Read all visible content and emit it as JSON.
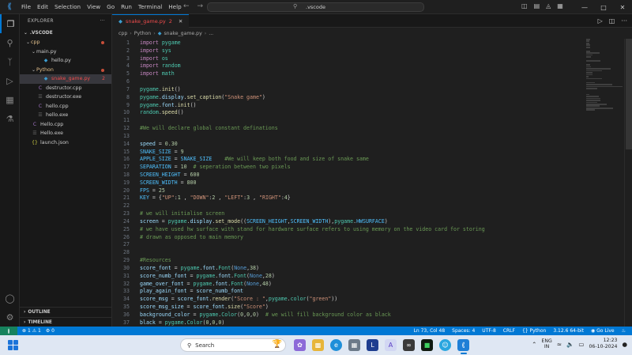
{
  "titlebar": {
    "menu": [
      "File",
      "Edit",
      "Selection",
      "View",
      "Go",
      "Run",
      "Terminal",
      "Help"
    ],
    "command_center": ".vscode"
  },
  "sidebar": {
    "header": "EXPLORER",
    "workspace": ".VSCODE",
    "tree": [
      {
        "label": "cpp",
        "depth": 1,
        "type": "folder",
        "open": true,
        "status": "dot"
      },
      {
        "label": "main.py",
        "depth": 2,
        "type": "folder",
        "open": true
      },
      {
        "label": "hello.py",
        "depth": 3,
        "type": "py"
      },
      {
        "label": "Python",
        "depth": 2,
        "type": "folder",
        "open": true,
        "status": "dot"
      },
      {
        "label": "snake_game.py",
        "depth": 3,
        "type": "py",
        "badge": "2",
        "selected": true
      },
      {
        "label": "destructor.cpp",
        "depth": 2,
        "type": "cpp"
      },
      {
        "label": "destructor.exe",
        "depth": 2,
        "type": "exe"
      },
      {
        "label": "hello.cpp",
        "depth": 2,
        "type": "cpp"
      },
      {
        "label": "hello.exe",
        "depth": 2,
        "type": "exe"
      },
      {
        "label": "Hello.cpp",
        "depth": 1,
        "type": "cpp"
      },
      {
        "label": "Hello.exe",
        "depth": 1,
        "type": "exe"
      },
      {
        "label": "launch.json",
        "depth": 1,
        "type": "json"
      }
    ],
    "outline": "OUTLINE",
    "timeline": "TIMELINE"
  },
  "editor": {
    "tab": {
      "label": "snake_game.py",
      "problems": "2"
    },
    "breadcrumb": [
      "cpp",
      "Python",
      "snake_game.py",
      "..."
    ],
    "lines": [
      [
        [
          "kw",
          "import"
        ],
        [
          "t",
          " "
        ],
        [
          "mod",
          "pygame"
        ]
      ],
      [
        [
          "kw",
          "import"
        ],
        [
          "t",
          " "
        ],
        [
          "mod",
          "sys"
        ]
      ],
      [
        [
          "kw",
          "import"
        ],
        [
          "t",
          " "
        ],
        [
          "mod",
          "os"
        ]
      ],
      [
        [
          "kw",
          "import"
        ],
        [
          "t",
          " "
        ],
        [
          "mod",
          "random"
        ]
      ],
      [
        [
          "kw",
          "import"
        ],
        [
          "t",
          " "
        ],
        [
          "mod",
          "math"
        ]
      ],
      [],
      [
        [
          "mod",
          "pygame"
        ],
        [
          "t",
          "."
        ],
        [
          "fn",
          "init"
        ],
        [
          "t",
          "()"
        ]
      ],
      [
        [
          "mod",
          "pygame"
        ],
        [
          "t",
          "."
        ],
        [
          "var",
          "display"
        ],
        [
          "t",
          "."
        ],
        [
          "fn",
          "set_caption"
        ],
        [
          "t",
          "("
        ],
        [
          "str",
          "\"Snake game\""
        ],
        [
          "t",
          ")"
        ]
      ],
      [
        [
          "mod",
          "pygame"
        ],
        [
          "t",
          "."
        ],
        [
          "var",
          "font"
        ],
        [
          "t",
          "."
        ],
        [
          "fn",
          "init"
        ],
        [
          "t",
          "()"
        ]
      ],
      [
        [
          "mod",
          "random"
        ],
        [
          "t",
          "."
        ],
        [
          "fn",
          "speed"
        ],
        [
          "t",
          "()"
        ]
      ],
      [],
      [
        [
          "cmt",
          "#We will declare global constant definations"
        ]
      ],
      [],
      [
        [
          "var",
          "speed"
        ],
        [
          "t",
          " = "
        ],
        [
          "num",
          "0.30"
        ]
      ],
      [
        [
          "const",
          "SNAKE_SIZE"
        ],
        [
          "t",
          " = "
        ],
        [
          "num",
          "9"
        ]
      ],
      [
        [
          "const",
          "APPLE_SIZE"
        ],
        [
          "t",
          " = "
        ],
        [
          "const",
          "SNAKE_SIZE"
        ],
        [
          "t",
          "    "
        ],
        [
          "cmt",
          "#We will keep both food and size of snake same"
        ]
      ],
      [
        [
          "const",
          "SEPARATION"
        ],
        [
          "t",
          " = "
        ],
        [
          "num",
          "10"
        ],
        [
          "t",
          "  "
        ],
        [
          "cmt",
          "# seperation between two pixels"
        ]
      ],
      [
        [
          "const",
          "SCREEN_HEIGHT"
        ],
        [
          "t",
          " = "
        ],
        [
          "num",
          "600"
        ]
      ],
      [
        [
          "const",
          "SCREEN_WIDTH"
        ],
        [
          "t",
          " = "
        ],
        [
          "num",
          "800"
        ]
      ],
      [
        [
          "const",
          "FPS"
        ],
        [
          "t",
          " = "
        ],
        [
          "num",
          "25"
        ]
      ],
      [
        [
          "const",
          "KEY"
        ],
        [
          "t",
          " = {"
        ],
        [
          "str",
          "\"UP\""
        ],
        [
          "t",
          ":"
        ],
        [
          "num",
          "1"
        ],
        [
          "t",
          " , "
        ],
        [
          "str",
          "\"DOWN\""
        ],
        [
          "t",
          ":"
        ],
        [
          "num",
          "2"
        ],
        [
          "t",
          " , "
        ],
        [
          "str",
          "\"LEFT\""
        ],
        [
          "t",
          ":"
        ],
        [
          "num",
          "3"
        ],
        [
          "t",
          " , "
        ],
        [
          "str",
          "\"RIGHT\""
        ],
        [
          "t",
          ":"
        ],
        [
          "num",
          "4"
        ],
        [
          "t",
          "}"
        ]
      ],
      [],
      [
        [
          "cmt",
          "# we will initialise screen"
        ]
      ],
      [
        [
          "var",
          "screen"
        ],
        [
          "t",
          " = "
        ],
        [
          "mod",
          "pygame"
        ],
        [
          "t",
          "."
        ],
        [
          "var",
          "display"
        ],
        [
          "t",
          "."
        ],
        [
          "fn",
          "set_mode"
        ],
        [
          "t",
          "(("
        ],
        [
          "const",
          "SCREEN_HEIGHT"
        ],
        [
          "t",
          ","
        ],
        [
          "const",
          "SCREEN_WIDTH"
        ],
        [
          "t",
          "),"
        ],
        [
          "mod",
          "pygame"
        ],
        [
          "t",
          "."
        ],
        [
          "const",
          "HWSURFACE"
        ],
        [
          "t",
          ")"
        ]
      ],
      [
        [
          "cmt",
          "# we have used hw surface with stand for hardware surface refers to using memory on the video card for storing"
        ]
      ],
      [
        [
          "cmt",
          "# drawn as opposed to main memory"
        ]
      ],
      [],
      [],
      [
        [
          "cmt",
          "#Resources"
        ]
      ],
      [
        [
          "var",
          "score_font"
        ],
        [
          "t",
          " = "
        ],
        [
          "mod",
          "pygame"
        ],
        [
          "t",
          "."
        ],
        [
          "var",
          "font"
        ],
        [
          "t",
          "."
        ],
        [
          "mod",
          "Font"
        ],
        [
          "t",
          "("
        ],
        [
          "kw2",
          "None"
        ],
        [
          "t",
          ","
        ],
        [
          "num",
          "38"
        ],
        [
          "t",
          ")"
        ]
      ],
      [
        [
          "var",
          "score_numb_font"
        ],
        [
          "t",
          " = "
        ],
        [
          "mod",
          "pygame"
        ],
        [
          "t",
          "."
        ],
        [
          "var",
          "font"
        ],
        [
          "t",
          "."
        ],
        [
          "mod",
          "Font"
        ],
        [
          "t",
          "("
        ],
        [
          "kw2",
          "None"
        ],
        [
          "t",
          ","
        ],
        [
          "num",
          "28"
        ],
        [
          "t",
          ")"
        ]
      ],
      [
        [
          "var",
          "game_over_font"
        ],
        [
          "t",
          " = "
        ],
        [
          "mod",
          "pygame"
        ],
        [
          "t",
          "."
        ],
        [
          "var",
          "font"
        ],
        [
          "t",
          "."
        ],
        [
          "mod",
          "Font"
        ],
        [
          "t",
          "("
        ],
        [
          "kw2",
          "None"
        ],
        [
          "t",
          ","
        ],
        [
          "num",
          "48"
        ],
        [
          "t",
          ")"
        ]
      ],
      [
        [
          "var",
          "play_again_font"
        ],
        [
          "t",
          " = "
        ],
        [
          "var",
          "score_numb_font"
        ]
      ],
      [
        [
          "var",
          "score_msg"
        ],
        [
          "t",
          " = "
        ],
        [
          "var",
          "score_font"
        ],
        [
          "t",
          "."
        ],
        [
          "fn",
          "render"
        ],
        [
          "t",
          "("
        ],
        [
          "str",
          "\"Score : \""
        ],
        [
          "t",
          ","
        ],
        [
          "mod",
          "pygame"
        ],
        [
          "t",
          "."
        ],
        [
          "mod",
          "color"
        ],
        [
          "t",
          "("
        ],
        [
          "str",
          "\"green\""
        ],
        [
          "t",
          "))"
        ]
      ],
      [
        [
          "var",
          "score_msg_size"
        ],
        [
          "t",
          " = "
        ],
        [
          "var",
          "score_font"
        ],
        [
          "t",
          "."
        ],
        [
          "fn",
          "size"
        ],
        [
          "t",
          "("
        ],
        [
          "str",
          "\"Score\""
        ],
        [
          "t",
          ")"
        ]
      ],
      [
        [
          "var",
          "background_color"
        ],
        [
          "t",
          " = "
        ],
        [
          "mod",
          "pygame"
        ],
        [
          "t",
          "."
        ],
        [
          "mod",
          "Color"
        ],
        [
          "t",
          "("
        ],
        [
          "num",
          "0"
        ],
        [
          "t",
          ","
        ],
        [
          "num",
          "0"
        ],
        [
          "t",
          ","
        ],
        [
          "num",
          "0"
        ],
        [
          "t",
          ")  "
        ],
        [
          "cmt",
          "# we will fill background color as black"
        ]
      ],
      [
        [
          "var",
          "black"
        ],
        [
          "t",
          " = "
        ],
        [
          "mod",
          "pygame"
        ],
        [
          "t",
          "."
        ],
        [
          "mod",
          "Color"
        ],
        [
          "t",
          "("
        ],
        [
          "num",
          "0"
        ],
        [
          "t",
          ","
        ],
        [
          "num",
          "0"
        ],
        [
          "t",
          ","
        ],
        [
          "num",
          "0"
        ],
        [
          "t",
          ")"
        ]
      ]
    ]
  },
  "statusbar": {
    "errors": "1",
    "warnings": "1",
    "ports": "0",
    "position": "Ln 73, Col 48",
    "spaces": "Spaces: 4",
    "encoding": "UTF-8",
    "eol": "CRLF",
    "language": "Python",
    "interpreter": "3.12.6 64-bit",
    "golive": "Go Live"
  },
  "taskbar": {
    "search_placeholder": "Search",
    "lang_top": "ENG",
    "lang_bottom": "IN",
    "time": "12:23",
    "date": "06-10-2024"
  },
  "colors": {
    "accent": "#0078d4",
    "error": "#f14c4c",
    "editor_bg": "#1f1f1f"
  }
}
